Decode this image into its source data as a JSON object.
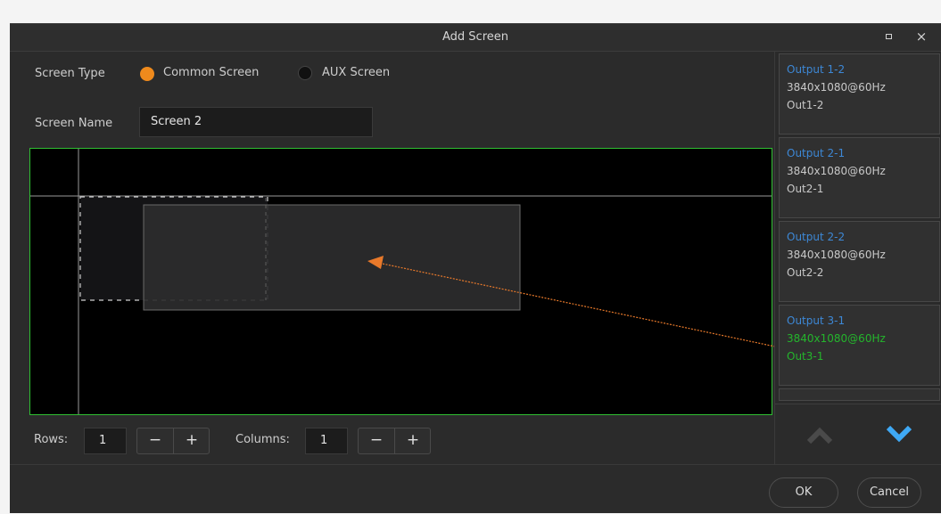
{
  "dialog": {
    "title": "Add Screen"
  },
  "screen_type": {
    "label": "Screen Type",
    "options": [
      {
        "label": "Common Screen",
        "selected": true,
        "color": "#ef8a1c"
      },
      {
        "label": "AUX Screen",
        "selected": false
      }
    ]
  },
  "screen_name": {
    "label": "Screen Name",
    "value": "Screen 2"
  },
  "outputs": [
    {
      "title": "Output 1-2",
      "resolution": "3840x1080@60Hz",
      "id": "Out1-2",
      "selected": false
    },
    {
      "title": "Output 2-1",
      "resolution": "3840x1080@60Hz",
      "id": "Out2-1",
      "selected": false
    },
    {
      "title": "Output 2-2",
      "resolution": "3840x1080@60Hz",
      "id": "Out2-2",
      "selected": false
    },
    {
      "title": "Output 3-1",
      "resolution": "3840x1080@60Hz",
      "id": "Out3-1",
      "selected": true
    }
  ],
  "grid": {
    "rows_label": "Rows:",
    "rows_value": "1",
    "columns_label": "Columns:",
    "columns_value": "1",
    "minus": "−",
    "plus": "+"
  },
  "footer": {
    "ok_label": "OK",
    "cancel_label": "Cancel"
  },
  "colors": {
    "accent": "#ef8a1c",
    "selection": "#24b52c",
    "output_title": "#3d88d6",
    "drag_arrow": "#e8792a"
  }
}
